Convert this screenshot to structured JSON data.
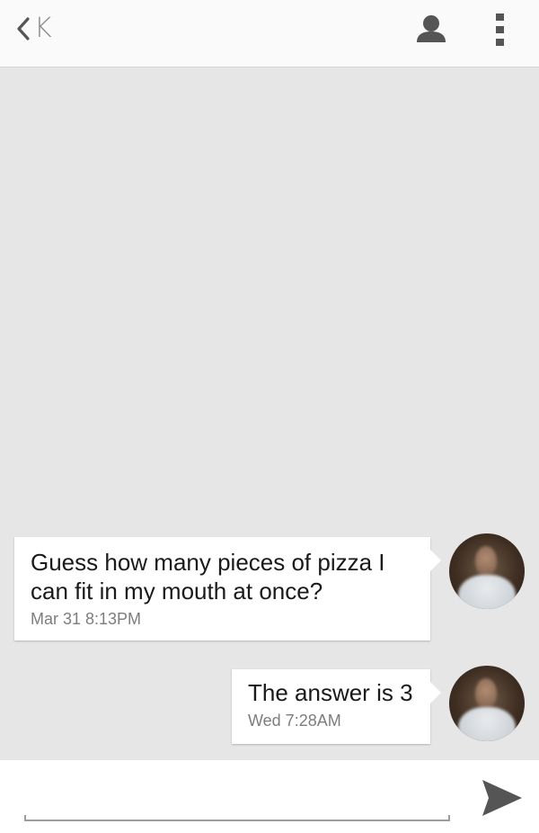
{
  "header": {
    "back_icon": "chevron-left-icon",
    "title": "K",
    "contact_icon": "person-icon",
    "menu_icon": "more-vert-icon"
  },
  "messages": [
    {
      "text": "Guess how many pieces of pizza I can fit in my mouth at once?",
      "timestamp": "Mar 31  8:13PM",
      "avatar": "avatar"
    },
    {
      "text": "The answer is 3",
      "timestamp": "Wed  7:28AM",
      "avatar": "avatar"
    }
  ],
  "composer": {
    "value": "",
    "placeholder": "",
    "send_icon": "send-icon"
  },
  "colors": {
    "background": "#e6e6e6",
    "topbar": "#fafafa",
    "bubble": "#ffffff",
    "icon": "#555555",
    "title": "#8a8a8a"
  }
}
